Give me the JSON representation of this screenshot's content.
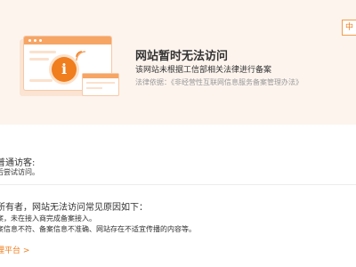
{
  "header": {
    "lang_badge": "中",
    "title": "网站暂时无法访问",
    "subtitle": "该网站未根据工信部相关法律进行备案",
    "legal_prefix": "法律依据：",
    "legal_link": "《非经营性互联网信息服务备案管理办法》"
  },
  "visitor": {
    "heading": "普通访客:",
    "tip": "后尝试访问。"
  },
  "owner": {
    "heading": "所有者，网站无法访问常见原因如下：",
    "reasons": [
      "案，未在接入商完成备案接入。",
      "案信息不符、备案信息不准确、网站存在不适宜传播的内容等。"
    ],
    "platform_link": "理平台 >"
  },
  "colors": {
    "accent": "#f07d1e",
    "hero_bg": "#fdf4ee"
  },
  "icons": {
    "main": "info-icon"
  }
}
